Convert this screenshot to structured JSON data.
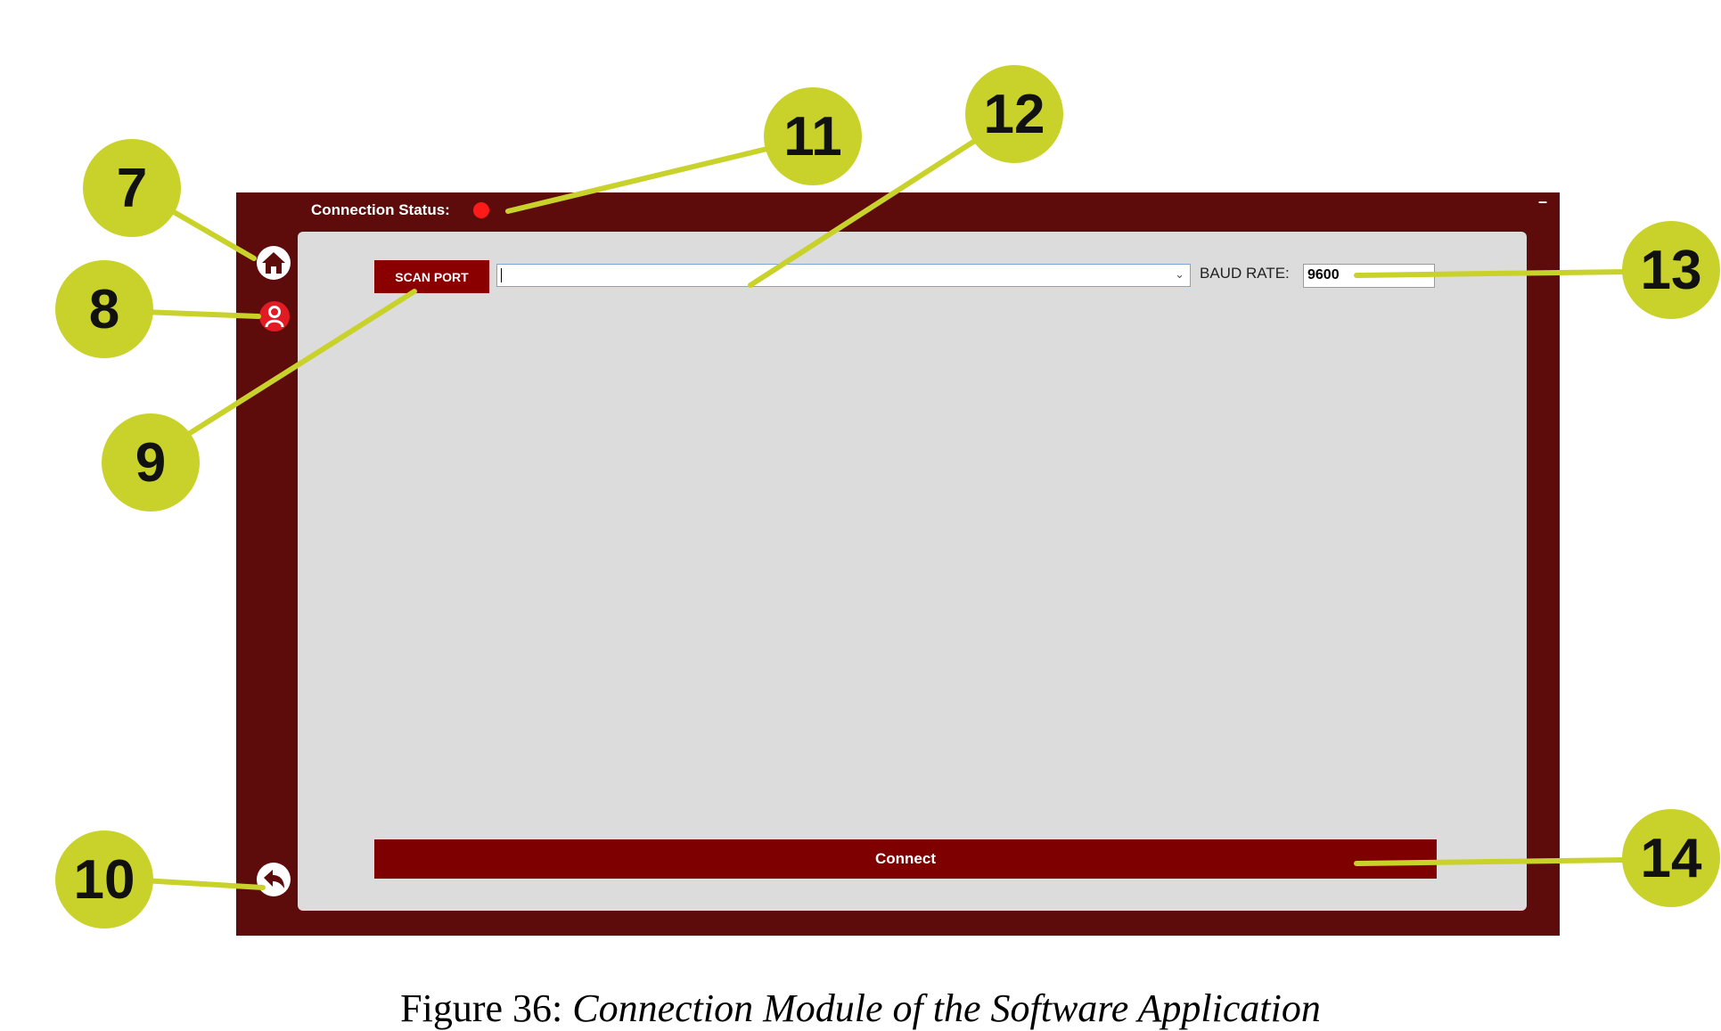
{
  "window": {
    "minimize_label": "–",
    "status_label": "Connection Status:",
    "status_color": "#ff1a1a",
    "frame_color": "#5e0b0c"
  },
  "sidebar": {
    "items": [
      {
        "icon": "home-icon"
      },
      {
        "icon": "user-icon"
      },
      {
        "icon": "back-icon"
      }
    ]
  },
  "toolbar": {
    "scan_label": "SCAN PORT",
    "port_value": "",
    "baud_label": "BAUD RATE:",
    "baud_value": "9600"
  },
  "footer": {
    "connect_label": "Connect"
  },
  "callouts": [
    "7",
    "8",
    "9",
    "10",
    "11",
    "12",
    "13",
    "14"
  ],
  "caption": {
    "prefix": "Figure 36:",
    "title": "Connection Module of the Software Application"
  },
  "colors": {
    "accent": "#8a0000",
    "panel": "#dcdcdc",
    "callout": "#c9d22a"
  }
}
